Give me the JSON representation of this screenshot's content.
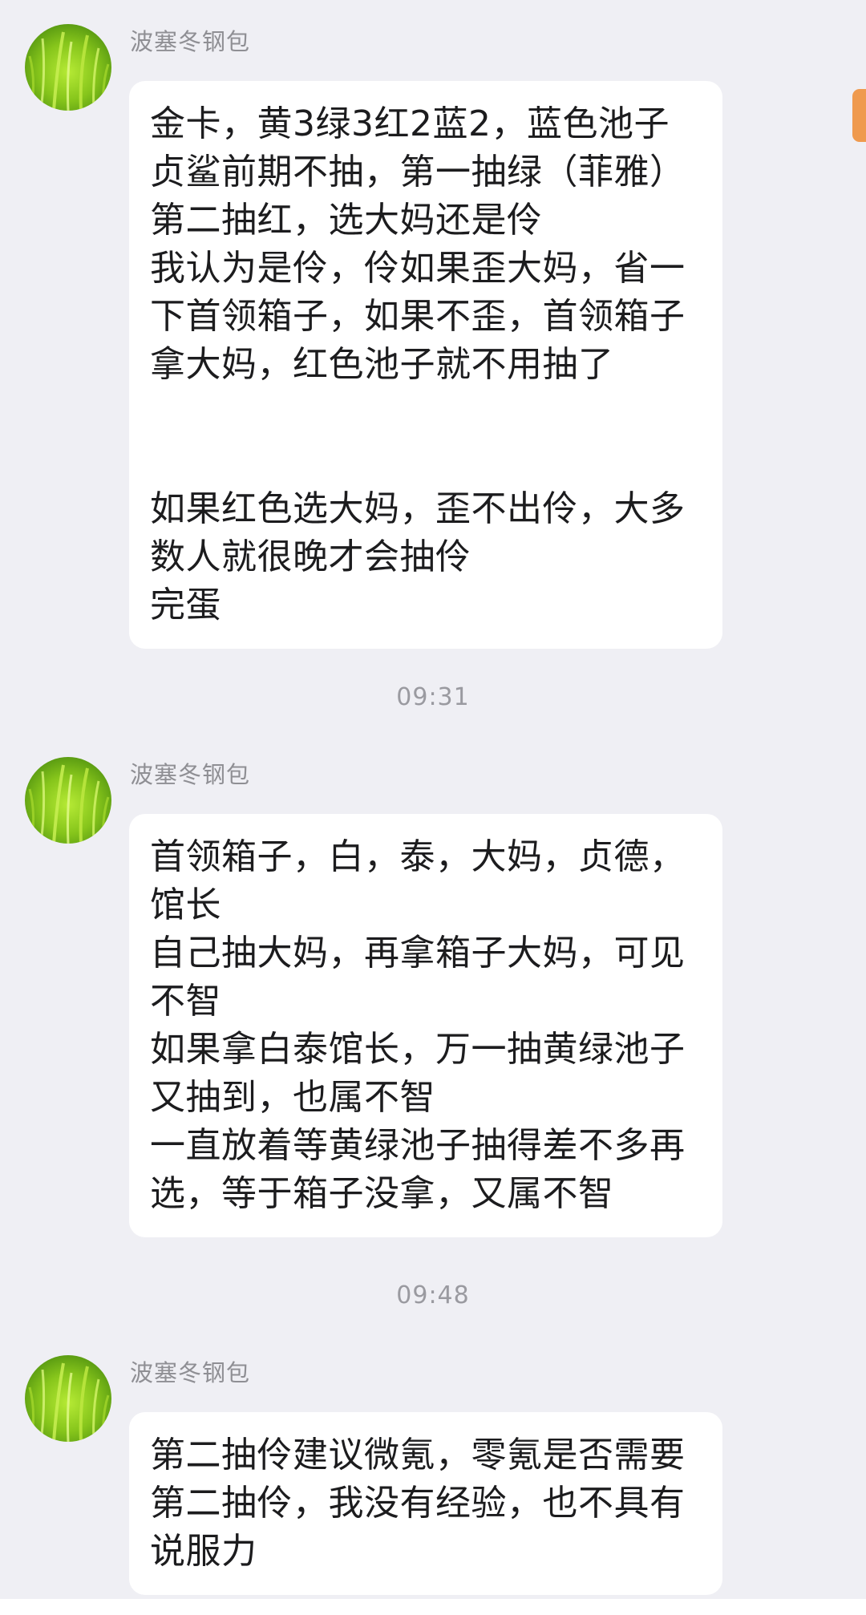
{
  "messages": [
    {
      "sender": "波塞冬钢包",
      "lines": [
        "金卡，黄3绿3红2蓝2，蓝色池子",
        "贞鲨前期不抽，第一抽绿（菲雅）",
        "第二抽红，选大妈还是伶",
        "我认为是伶，伶如果歪大妈，省一",
        "下首领箱子，如果不歪，首领箱子",
        "拿大妈，红色池子就不用抽了",
        "",
        "",
        "如果红色选大妈，歪不出伶，大多",
        "数人就很晚才会抽伶",
        "完蛋"
      ]
    },
    {
      "timestamp": "09:31",
      "sender": "波塞冬钢包",
      "lines": [
        "首领箱子，白，泰，大妈，贞德，",
        "馆长",
        "自己抽大妈，再拿箱子大妈，可见",
        "不智",
        "如果拿白泰馆长，万一抽黄绿池子",
        "又抽到，也属不智",
        "一直放着等黄绿池子抽得差不多再",
        "选，等于箱子没拿，又属不智"
      ]
    },
    {
      "timestamp": "09:48",
      "sender": "波塞冬钢包",
      "lines": [
        "第二抽伶建议微氪，零氪是否需要",
        "第二抽伶，我没有经验，也不具有",
        "说服力"
      ]
    }
  ],
  "colors": {
    "background": "#efeff4",
    "bubble": "#ffffff",
    "scroll_indicator": "#ef9a4e",
    "sender_name": "#8f8f94",
    "timestamp": "#9a9aa0"
  },
  "icons": {
    "avatar": "green-grass-avatar-icon"
  }
}
